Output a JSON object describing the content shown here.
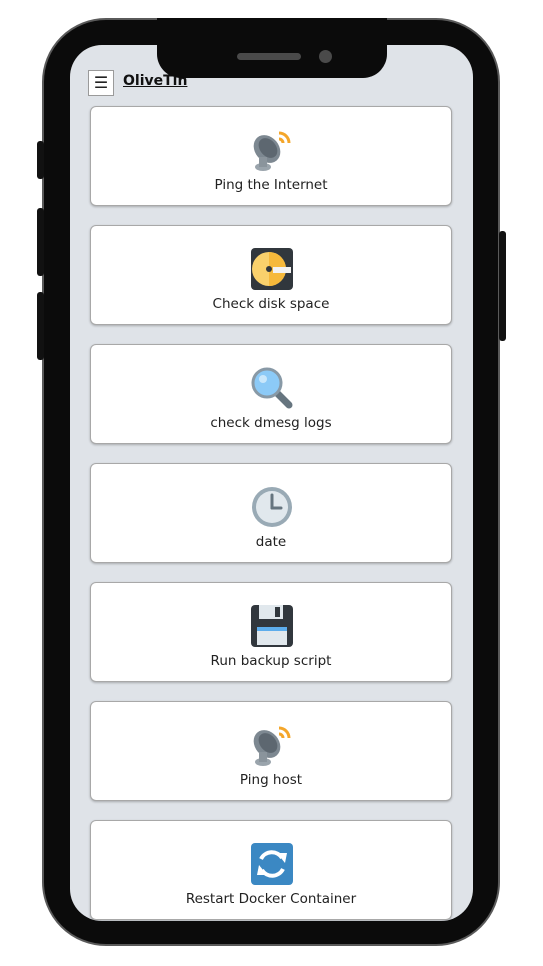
{
  "app": {
    "title": "OliveTin",
    "menu_icon": "hamburger-menu-icon"
  },
  "actions": [
    {
      "label": "Ping the Internet",
      "icon": "satellite-dish-icon"
    },
    {
      "label": "Check disk space",
      "icon": "disk-icon"
    },
    {
      "label": "check dmesg logs",
      "icon": "magnifier-icon"
    },
    {
      "label": "date",
      "icon": "clock-icon"
    },
    {
      "label": "Run backup script",
      "icon": "floppy-disk-icon"
    },
    {
      "label": "Ping host",
      "icon": "satellite-dish-icon"
    },
    {
      "label": "Restart Docker Container",
      "icon": "restart-arrows-icon"
    }
  ]
}
